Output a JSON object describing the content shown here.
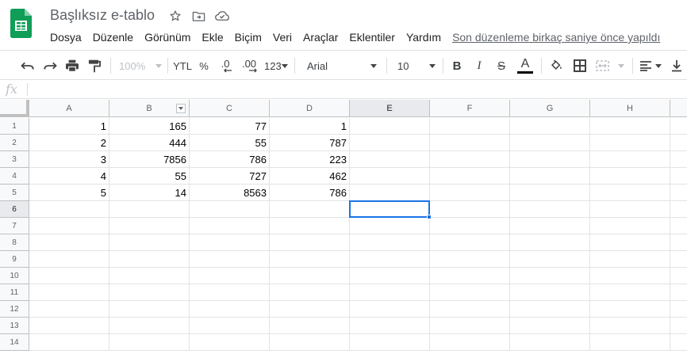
{
  "header": {
    "title": "Başlıksız e-tablo",
    "last_edit": "Son düzenleme birkaç saniye önce yapıldı"
  },
  "menu": [
    "Dosya",
    "Düzenle",
    "Görünüm",
    "Ekle",
    "Biçim",
    "Veri",
    "Araçlar",
    "Eklentiler",
    "Yardım"
  ],
  "toolbar": {
    "zoom": "100%",
    "currency": "YTL",
    "percent": "%",
    "decrease_decimals": ".0",
    "increase_decimals": ".00",
    "more_formats": "123",
    "font": "Arial",
    "font_size": "10",
    "bold": "B",
    "italic": "I",
    "strikethrough": "S",
    "text_color_letter": "A"
  },
  "formula_bar": {
    "fx": "fx",
    "value": ""
  },
  "grid": {
    "columns": [
      "A",
      "B",
      "C",
      "D",
      "E",
      "F",
      "G",
      "H"
    ],
    "rows": [
      "1",
      "2",
      "3",
      "4",
      "5",
      "6",
      "7",
      "8",
      "9",
      "10",
      "11",
      "12",
      "13",
      "14"
    ],
    "cells": [
      [
        "1",
        "165",
        "77",
        "1"
      ],
      [
        "2",
        "444",
        "55",
        "787"
      ],
      [
        "3",
        "7856",
        "786",
        "223"
      ],
      [
        "4",
        "55",
        "727",
        "462"
      ],
      [
        "5",
        "14",
        "8563",
        "786"
      ]
    ],
    "selected_cell": "E6"
  },
  "colors": {
    "accent": "#1a73e8",
    "sheets_green": "#0f9d58"
  }
}
